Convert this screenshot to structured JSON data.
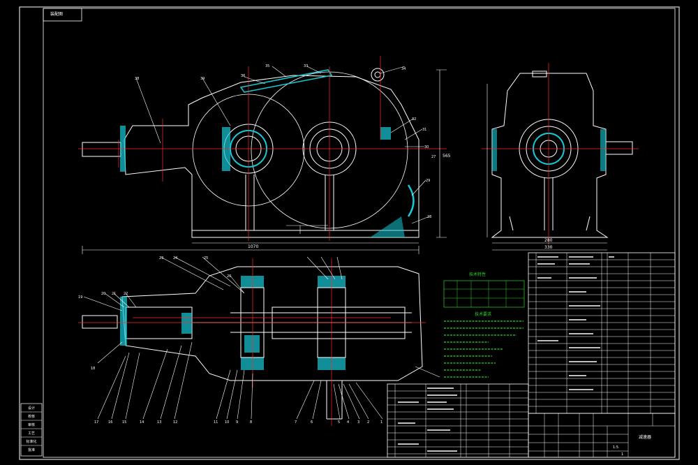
{
  "drawing": {
    "title_block_tag": "装配图",
    "tech_req_title": "技术要求",
    "tech_params_title": "技术特性",
    "dims": {
      "overall_length": "1070",
      "bottom_width": "280",
      "center_width": "330",
      "height": "565"
    },
    "left_side_labels": [
      "设计",
      "校核",
      "审核",
      "工艺",
      "标准化",
      "批准"
    ],
    "title_block": {
      "scale": "1:5",
      "sheet": "1",
      "drawing_name": "减速器"
    },
    "balloons_front": [
      "38",
      "39",
      "36",
      "35",
      "33",
      "34",
      "32",
      "31",
      "30",
      "29",
      "28",
      "27"
    ],
    "balloons_plan": [
      "19",
      "20",
      "21",
      "22",
      "23",
      "24",
      "25",
      "26",
      "18",
      "17",
      "16",
      "15",
      "14",
      "13",
      "12",
      "11",
      "10",
      "9",
      "8",
      "7",
      "6",
      "5",
      "4",
      "3",
      "2",
      "1"
    ],
    "colors": {
      "background": "#000000",
      "line": "#ffffff",
      "center_line": "#ff2b2b",
      "section": "#17c9d6",
      "text_green": "#2bd62b",
      "leader": "#ffffff"
    }
  }
}
